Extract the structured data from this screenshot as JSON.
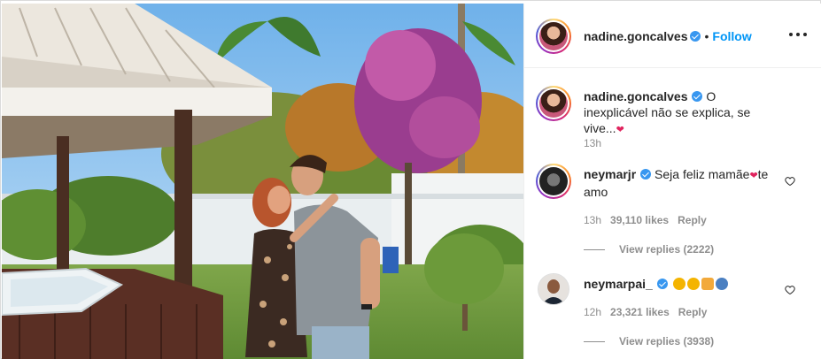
{
  "post": {
    "author": "nadine.goncalves",
    "follow_label": "Follow",
    "dot": "•",
    "caption": "O inexplicável não se explica, se vive...",
    "caption_time": "13h"
  },
  "icons": {
    "verified": "verified-badge-icon",
    "more": "more-options-icon",
    "like": "heart-outline-icon",
    "heart": "red-heart-emoji",
    "clap": "clapping-hands-emoji",
    "muscle": "flexed-biceps-emoji",
    "person": "person-emoji"
  },
  "comments": [
    {
      "username": "neymarjr",
      "text": "Seja feliz mamãe",
      "text_after": "te amo",
      "time": "13h",
      "likes": "39,110 likes",
      "reply_label": "Reply",
      "view_replies": "View replies (2222)"
    },
    {
      "username": "neymarpai_",
      "text": "",
      "time": "12h",
      "likes": "23,321 likes",
      "reply_label": "Reply",
      "view_replies": "View replies (3938)"
    }
  ],
  "colors": {
    "link": "#0095f6",
    "verified": "#3897f0",
    "muted": "#8e8e8e",
    "text": "#262626",
    "heart": "#e0245e"
  }
}
